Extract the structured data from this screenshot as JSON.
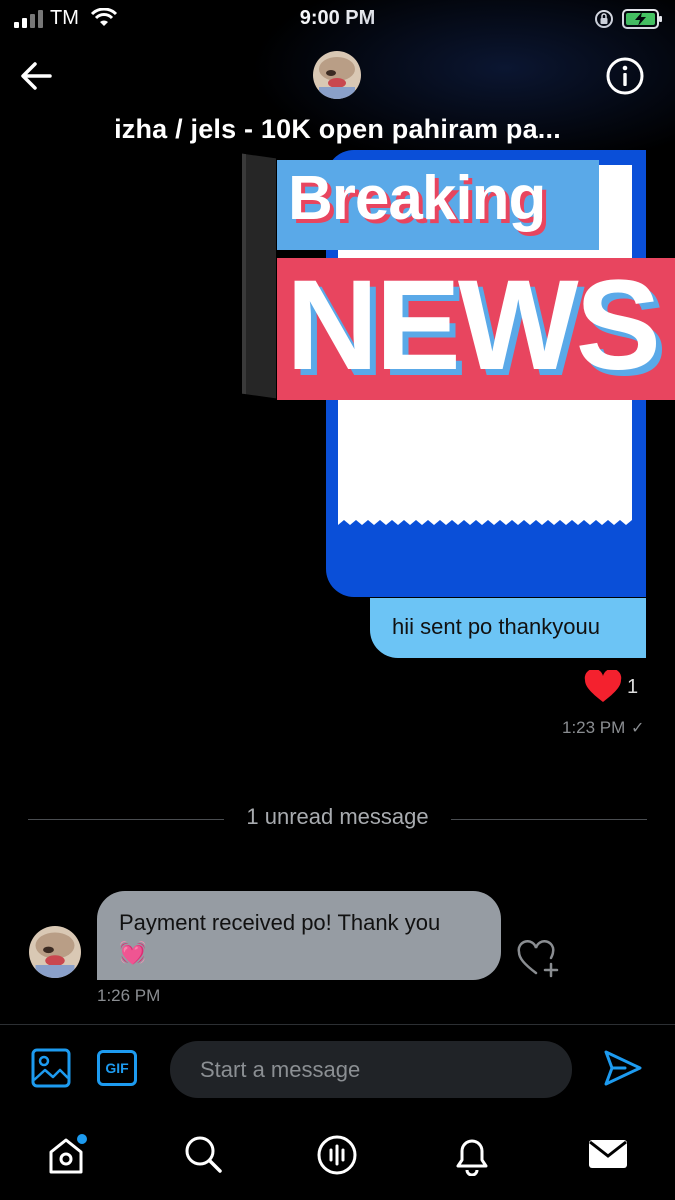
{
  "status_bar": {
    "carrier": "TM",
    "time": "9:00 PM"
  },
  "header": {
    "title": "izha / jels - 10K open pahiram pa..."
  },
  "image_message": {
    "overlay_line1": "Breaking",
    "overlay_line2": "NEWS"
  },
  "sent_message": {
    "text": "hii sent po thankyouu",
    "likes": "1",
    "time": "1:23 PM",
    "status": "✓"
  },
  "divider": {
    "label": "1 unread message"
  },
  "received_message": {
    "text": "Payment received po! Thank you",
    "emoji": "💓",
    "time": "1:26 PM"
  },
  "composer": {
    "gif_label": "GIF",
    "placeholder": "Start a message"
  },
  "colors": {
    "accent": "#1d9bf0",
    "sent_bubble": "#6cc4f5",
    "received_bubble": "#969ca3",
    "heart": "#f4212e"
  }
}
